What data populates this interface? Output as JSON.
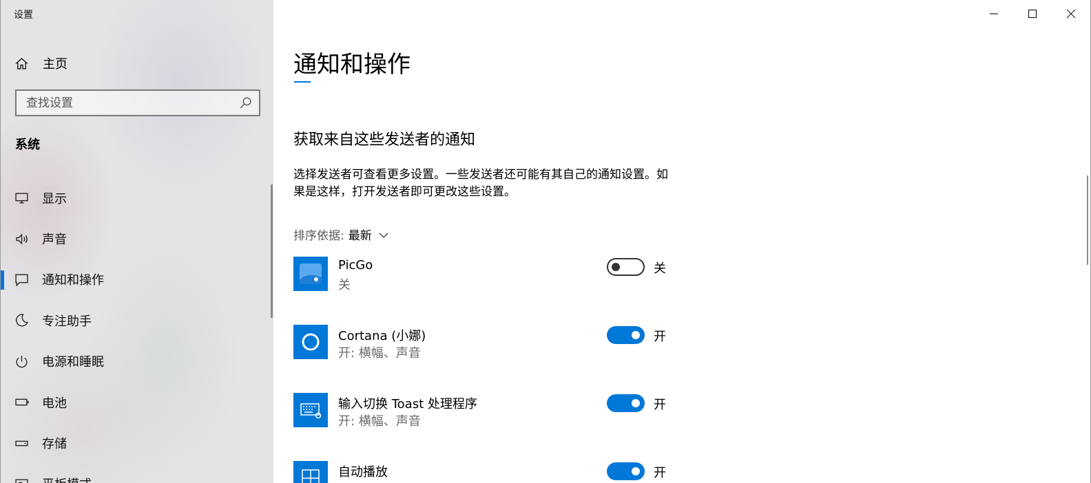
{
  "window": {
    "app_title": "设置",
    "controls": [
      "minimize-icon",
      "maximize-icon",
      "close-icon"
    ]
  },
  "sidebar": {
    "home_label": "主页",
    "search_placeholder": "查找设置",
    "section_title": "系统",
    "items": [
      {
        "label": "显示",
        "icon": "display-icon",
        "active": false
      },
      {
        "label": "声音",
        "icon": "speaker-icon",
        "active": false
      },
      {
        "label": "通知和操作",
        "icon": "notification-icon",
        "active": true
      },
      {
        "label": "专注助手",
        "icon": "moon-icon",
        "active": false
      },
      {
        "label": "电源和睡眠",
        "icon": "power-icon",
        "active": false
      },
      {
        "label": "电池",
        "icon": "battery-icon",
        "active": false
      },
      {
        "label": "存储",
        "icon": "storage-icon",
        "active": false
      },
      {
        "label": "平板模式",
        "icon": "tablet-icon",
        "active": false
      }
    ]
  },
  "main": {
    "page_title": "通知和操作",
    "section_title": "获取来自这些发送者的通知",
    "description": "选择发送者可查看更多设置。一些发送者还可能有其自己的通知设置。如果是这样，打开发送者即可更改这些设置。",
    "sort": {
      "label": "排序依据:",
      "value": "最新"
    },
    "senders": [
      {
        "name": "PicGo",
        "status": "关",
        "toggle_on": false,
        "toggle_label": "关",
        "icon": "picgo-icon"
      },
      {
        "name": "Cortana (小娜)",
        "status": "开: 横幅、声音",
        "toggle_on": true,
        "toggle_label": "开",
        "icon": "cortana-icon"
      },
      {
        "name": "输入切换 Toast 处理程序",
        "status": "开: 横幅、声音",
        "toggle_on": true,
        "toggle_label": "开",
        "icon": "keyboard-icon"
      },
      {
        "name": "自动播放",
        "status": "",
        "toggle_on": true,
        "toggle_label": "开",
        "icon": "autoplay-icon"
      }
    ]
  },
  "colors": {
    "accent": "#0078d7",
    "sidebar_bg": "#e4e4e6",
    "secondary_text": "#6b6b6b"
  }
}
